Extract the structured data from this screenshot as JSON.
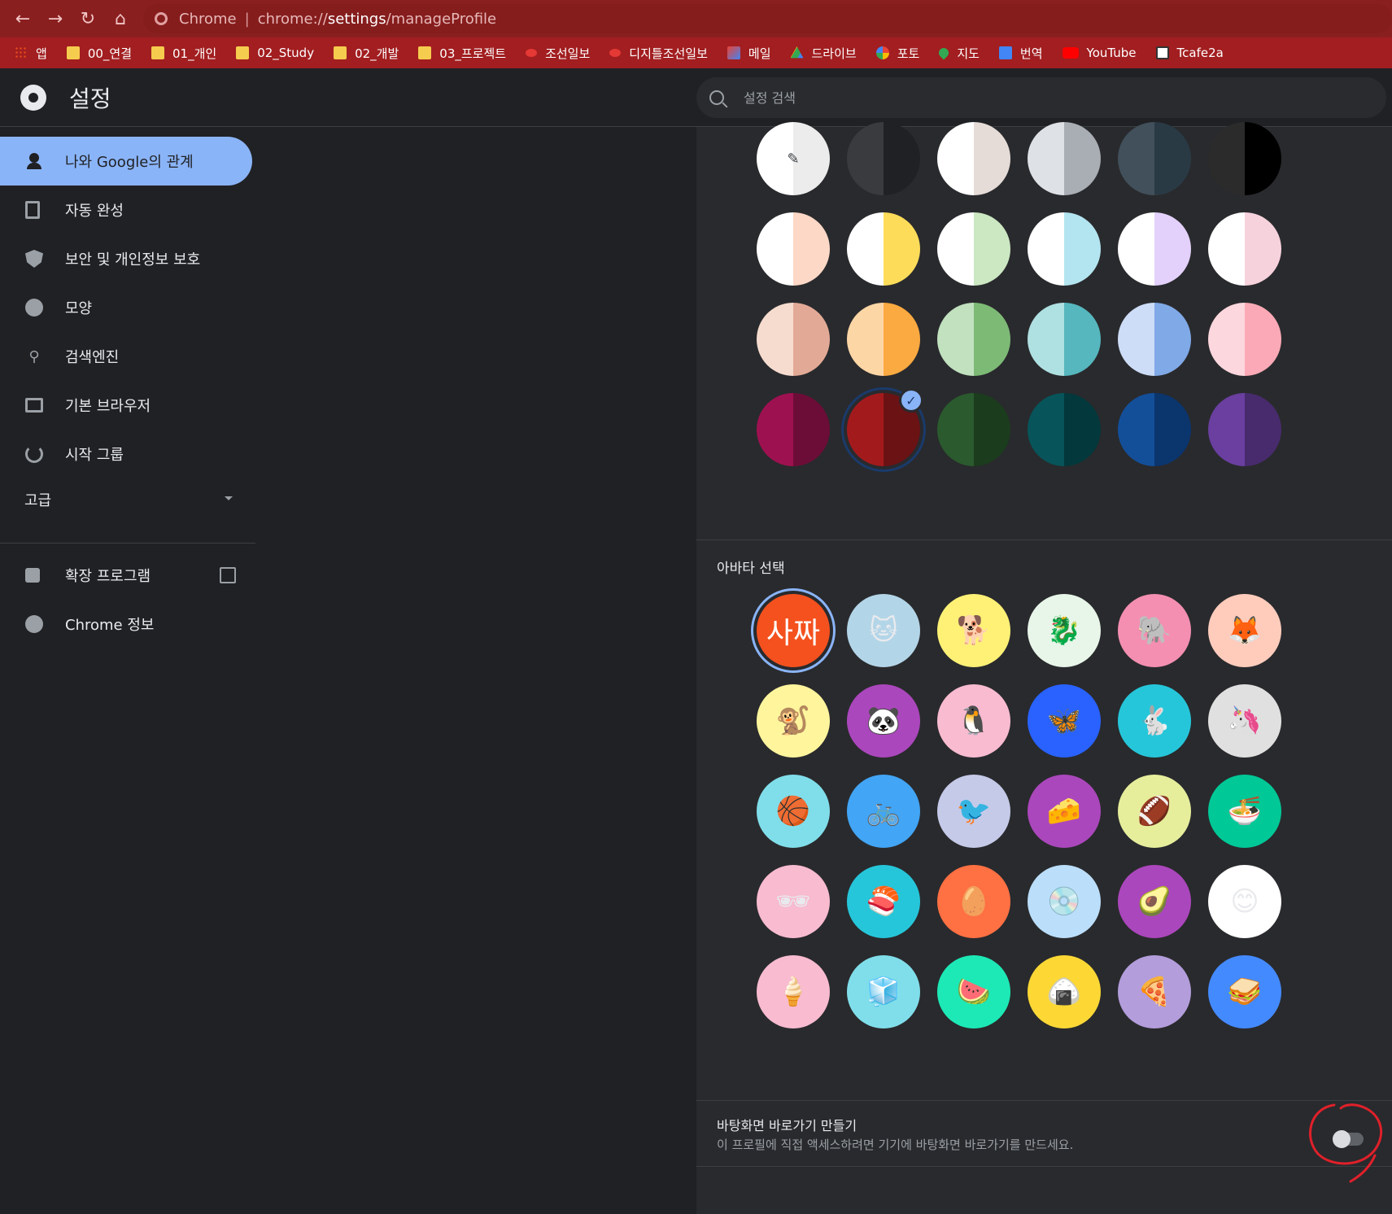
{
  "browser": {
    "omnibox": {
      "proto": "Chrome",
      "url_scheme": "chrome://",
      "url_host": "settings",
      "url_path": "/manageProfile"
    },
    "bookmarks": [
      {
        "label": "앱",
        "icon": "apps-grid-icon"
      },
      {
        "label": "00_연결",
        "icon": "folder-icon"
      },
      {
        "label": "01_개인",
        "icon": "folder-icon"
      },
      {
        "label": "02_Study",
        "icon": "folder-icon"
      },
      {
        "label": "02_개발",
        "icon": "folder-icon"
      },
      {
        "label": "03_프로젝트",
        "icon": "folder-icon"
      },
      {
        "label": "조선일보",
        "icon": "chosun-icon"
      },
      {
        "label": "디지틀조선일보",
        "icon": "chosun-icon"
      },
      {
        "label": "메일",
        "icon": "gmail-icon"
      },
      {
        "label": "드라이브",
        "icon": "drive-icon"
      },
      {
        "label": "포토",
        "icon": "photos-icon"
      },
      {
        "label": "지도",
        "icon": "maps-icon"
      },
      {
        "label": "번역",
        "icon": "translate-icon"
      },
      {
        "label": "YouTube",
        "icon": "youtube-icon"
      },
      {
        "label": "Tcafe2a",
        "icon": "tcafe-icon"
      }
    ]
  },
  "header": {
    "title": "설정",
    "search_placeholder": "설정 검색"
  },
  "sidebar": {
    "items": [
      {
        "label": "나와 Google의 관계",
        "icon": "person-icon",
        "active": true
      },
      {
        "label": "자동 완성",
        "icon": "clipboard-icon"
      },
      {
        "label": "보안 및 개인정보 보호",
        "icon": "shield-icon"
      },
      {
        "label": "모양",
        "icon": "palette-icon"
      },
      {
        "label": "검색엔진",
        "icon": "search-icon"
      },
      {
        "label": "기본 브라우저",
        "icon": "browser-icon"
      },
      {
        "label": "시작 그룹",
        "icon": "power-icon"
      }
    ],
    "advanced": "고급",
    "extensions": "확장 프로그램",
    "about": "Chrome 정보"
  },
  "theme_colors": [
    [
      [
        "#ffffff",
        "#ececec"
      ],
      [
        "#3a3b3e",
        "#202124"
      ],
      [
        "#ffffff",
        "#e5dcd8"
      ],
      [
        "#dee1e6",
        "#a9adb4"
      ],
      [
        "#41505a",
        "#2a3a45"
      ],
      [
        "#2b2b2b",
        "#000000"
      ]
    ],
    [
      [
        "#ffffff",
        "#fdd8c6"
      ],
      [
        "#ffffff",
        "#fddc5a"
      ],
      [
        "#ffffff",
        "#cbe8c2"
      ],
      [
        "#ffffff",
        "#b3e5f0"
      ],
      [
        "#ffffff",
        "#e3d1fb"
      ],
      [
        "#ffffff",
        "#f6d2dd"
      ]
    ],
    [
      [
        "#f6dccf",
        "#e2aa96"
      ],
      [
        "#fdd6a6",
        "#fba941"
      ],
      [
        "#c1e1bf",
        "#7dba76"
      ],
      [
        "#afe0e2",
        "#56b7be"
      ],
      [
        "#cddcf7",
        "#80a9e7"
      ],
      [
        "#fdd7de",
        "#fba9b6"
      ]
    ],
    [
      [
        "#9e1151",
        "#6c0d37"
      ],
      [
        "#a31a1d",
        "#6b1214"
      ],
      [
        "#2a5a2e",
        "#1b3c1d"
      ],
      [
        "#07545a",
        "#03383c"
      ],
      [
        "#134f99",
        "#0b356d"
      ],
      [
        "#6a3fa0",
        "#472b6c"
      ]
    ]
  ],
  "selected_theme": {
    "row": 3,
    "col": 1
  },
  "avatar_section_label": "아바타 선택",
  "monogram": "사짜",
  "avatars": [
    [
      {
        "name": "monogram",
        "bg": "#f4511e"
      },
      {
        "name": "cat",
        "bg": "#b3d5e8",
        "glyph": "🐱"
      },
      {
        "name": "corgi",
        "bg": "#fff176",
        "glyph": "🐕"
      },
      {
        "name": "dragon",
        "bg": "#e8f5e9",
        "glyph": "🐉"
      },
      {
        "name": "elephant",
        "bg": "#f48fb1",
        "glyph": "🐘"
      },
      {
        "name": "fox",
        "bg": "#ffccbc",
        "glyph": "🦊"
      }
    ],
    [
      {
        "name": "monkey",
        "bg": "#fff59d",
        "glyph": "🐒"
      },
      {
        "name": "panda",
        "bg": "#ab47bc",
        "glyph": "🐼"
      },
      {
        "name": "penguin",
        "bg": "#f8bbd0",
        "glyph": "🐧"
      },
      {
        "name": "butterfly",
        "bg": "#2962ff",
        "glyph": "🦋"
      },
      {
        "name": "rabbit",
        "bg": "#26c6da",
        "glyph": "🐇"
      },
      {
        "name": "unicorn",
        "bg": "#e0e0e0",
        "glyph": "🦄"
      }
    ],
    [
      {
        "name": "basketball",
        "bg": "#80deea",
        "glyph": "🏀"
      },
      {
        "name": "bike",
        "bg": "#42a5f5",
        "glyph": "🚲"
      },
      {
        "name": "bird",
        "bg": "#c5cae9",
        "glyph": "🐦"
      },
      {
        "name": "cheese",
        "bg": "#ab47bc",
        "glyph": "🧀"
      },
      {
        "name": "football",
        "bg": "#e6ee9c",
        "glyph": "🏈"
      },
      {
        "name": "ramen",
        "bg": "#00c897",
        "glyph": "🍜"
      }
    ],
    [
      {
        "name": "sunglasses",
        "bg": "#f8bbd0",
        "glyph": "🕶"
      },
      {
        "name": "sushi",
        "bg": "#26c6da",
        "glyph": "🍣"
      },
      {
        "name": "tamagotchi",
        "bg": "#ff7043",
        "glyph": "🥚"
      },
      {
        "name": "vinyl",
        "bg": "#bbdefb",
        "glyph": "💿"
      },
      {
        "name": "avocado",
        "bg": "#ab47bc",
        "glyph": "🥑"
      },
      {
        "name": "smile",
        "bg": "#ffffff",
        "glyph": "😊"
      }
    ],
    [
      {
        "name": "ice-cream",
        "bg": "#f8bbd0",
        "glyph": "🍦"
      },
      {
        "name": "popsicle",
        "bg": "#80deea",
        "glyph": "🧊"
      },
      {
        "name": "watermelon",
        "bg": "#1de9b6",
        "glyph": "🍉"
      },
      {
        "name": "onigiri",
        "bg": "#fdd835",
        "glyph": "🍙"
      },
      {
        "name": "pizza",
        "bg": "#b39ddb",
        "glyph": "🍕"
      },
      {
        "name": "sandwich",
        "bg": "#448aff",
        "glyph": "🥪"
      }
    ]
  ],
  "shortcut": {
    "title": "바탕화면 바로가기 만들기",
    "description": "이 프로필에 직접 액세스하려면 기기에 바탕화면 바로가기를 만드세요.",
    "enabled": false
  },
  "colors": {
    "accent": "#8ab4f8",
    "annotation": "#e0202a"
  }
}
